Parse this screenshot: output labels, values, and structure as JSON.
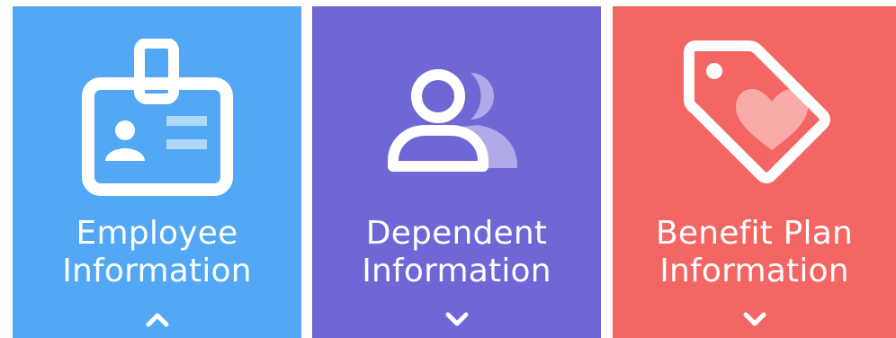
{
  "tiles": [
    {
      "line1": "Employee",
      "line2": "Information",
      "color": "#52a8f5",
      "icon": "id-badge-icon",
      "chevron": "chevron-up-icon"
    },
    {
      "line1": "Dependent",
      "line2": "Information",
      "color": "#6f67d6",
      "icon": "people-icon",
      "chevron": "chevron-down-icon"
    },
    {
      "line1": "Benefit Plan",
      "line2": "Information",
      "color": "#f46663",
      "icon": "heart-tag-icon",
      "chevron": "chevron-down-icon"
    }
  ]
}
